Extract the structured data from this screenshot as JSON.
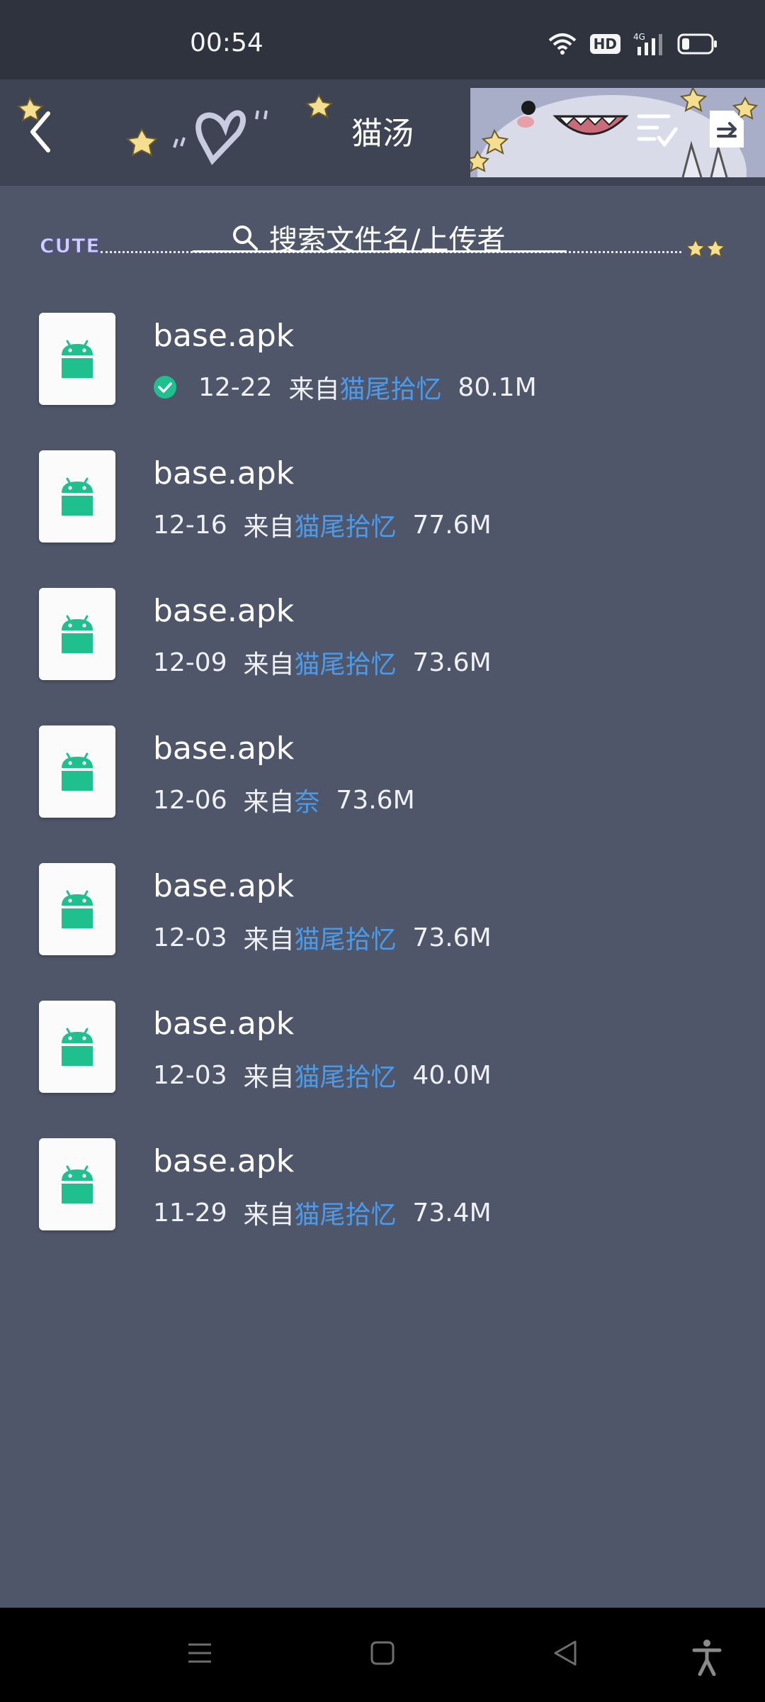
{
  "status_bar": {
    "time": "00:54",
    "network": "4G",
    "hd": "HD"
  },
  "header": {
    "title": "猫汤"
  },
  "search": {
    "placeholder": "搜索文件名/上传者",
    "badge": "CUTE"
  },
  "files": [
    {
      "name": "base.apk",
      "date": "12-22",
      "from": "来自",
      "uploader": "猫尾拾忆",
      "size": "80.1M",
      "downloaded": true
    },
    {
      "name": "base.apk",
      "date": "12-16",
      "from": "来自",
      "uploader": "猫尾拾忆",
      "size": "77.6M",
      "downloaded": false
    },
    {
      "name": "base.apk",
      "date": "12-09",
      "from": "来自",
      "uploader": "猫尾拾忆",
      "size": "73.6M",
      "downloaded": false
    },
    {
      "name": "base.apk",
      "date": "12-06",
      "from": "来自",
      "uploader": "奈",
      "size": "73.6M",
      "downloaded": false
    },
    {
      "name": "base.apk",
      "date": "12-03",
      "from": "来自",
      "uploader": "猫尾拾忆",
      "size": "73.6M",
      "downloaded": false
    },
    {
      "name": "base.apk",
      "date": "12-03",
      "from": "来自",
      "uploader": "猫尾拾忆",
      "size": "40.0M",
      "downloaded": false
    },
    {
      "name": "base.apk",
      "date": "11-29",
      "from": "来自",
      "uploader": "猫尾拾忆",
      "size": "73.4M",
      "downloaded": false
    }
  ],
  "colors": {
    "background": "#4f5669",
    "uploader_link": "#4d9be8",
    "android_green": "#1fc08e",
    "check_green": "#1fc08e"
  },
  "icons": {
    "back": "chevron-left-icon",
    "list_check": "list-check-icon",
    "upload": "upload-file-icon",
    "search": "search-icon",
    "file": "android-icon"
  }
}
